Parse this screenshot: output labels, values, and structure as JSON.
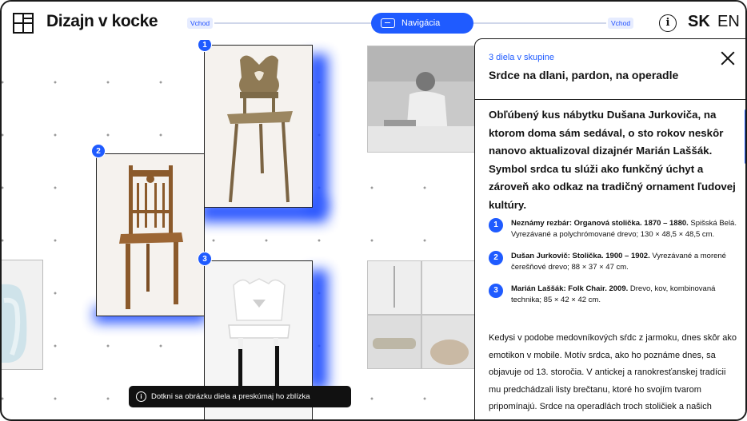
{
  "header": {
    "logo_text": "Dizajn v kocke",
    "left_chip": "Vchod",
    "nav_label": "Navigácia",
    "right_chip": "Vchod",
    "info_glyph": "i",
    "lang_active": "SK",
    "lang_other": "EN"
  },
  "canvas": {
    "badges": [
      "1",
      "2",
      "3"
    ],
    "tooltip": "Dotkni sa obrázku diela a preskúmaj ho zblízka",
    "tooltip_glyph": "i"
  },
  "panel": {
    "group_count": "3 diela v skupine",
    "title": "Srdce na dlani, pardon, na operadle",
    "lead": "Obľúbený kus nábytku Dušana Jurkoviča, na ktorom doma sám sedával, o sto rokov neskôr nanovo aktualizoval dizajnér Marián Laššák. Symbol srdca tu slúži ako funkčný úchyt a zároveň ako odkaz na tradičný ornament ľudovej kultúry.",
    "works": [
      {
        "num": "1",
        "title": "Neznámy rezbár: Organová stolička. 1870 – 1880.",
        "details": "Spišská Belá. Vyrezávané a polychrómované drevo; 130 × 48,5 × 48,5 cm."
      },
      {
        "num": "2",
        "title": "Dušan Jurkovič: Stolička. 1900 – 1902.",
        "details": "Vyrezávané a morené čerešňové drevo; 88 × 37 × 47 cm."
      },
      {
        "num": "3",
        "title": "Marián Laššák: Folk Chair. 2009.",
        "details": "Drevo, kov, kombinovaná technika; 85 × 42 × 42 cm."
      }
    ],
    "body": "Kedysi v podobe medovníkových sŕdc z jarmoku, dnes skôr ako emotikon v mobile. Motív srdca, ako ho poznáme dnes, sa objavuje od 13. storočia. V antickej a ranokresťanskej tradícii mu predchádzali listy brečtanu, ktoré ho svojím tvarom pripomínajú. Srdce na operadlách troch stoličiek a našich obrazk"
  },
  "colors": {
    "accent": "#1f5bff",
    "glow": "#1f4dff",
    "tooltip_bg": "#111111"
  }
}
